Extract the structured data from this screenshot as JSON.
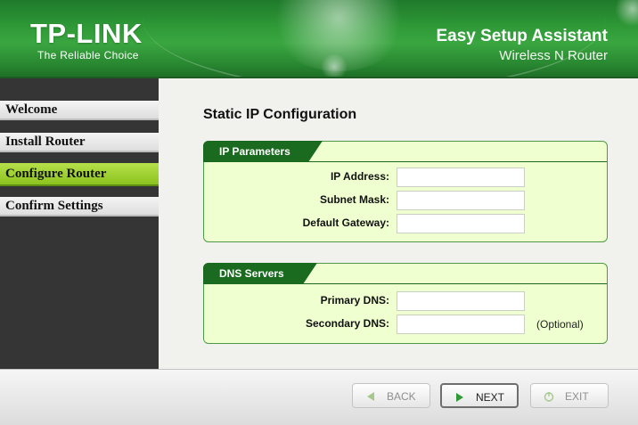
{
  "header": {
    "logo": "TP-LINK",
    "tagline": "The Reliable Choice",
    "title": "Easy Setup Assistant",
    "subtitle": "Wireless N Router"
  },
  "sidebar": {
    "items": [
      {
        "label": "Welcome",
        "active": false
      },
      {
        "label": "Install Router",
        "active": false
      },
      {
        "label": "Configure Router",
        "active": true
      },
      {
        "label": "Confirm Settings",
        "active": false
      }
    ]
  },
  "main": {
    "page_title": "Static IP Configuration",
    "ip_parameters": {
      "legend": "IP Parameters",
      "fields": {
        "ip_address": {
          "label": "IP Address:",
          "value": ""
        },
        "subnet_mask": {
          "label": "Subnet Mask:",
          "value": ""
        },
        "default_gateway": {
          "label": "Default Gateway:",
          "value": ""
        }
      }
    },
    "dns_servers": {
      "legend": "DNS Servers",
      "fields": {
        "primary_dns": {
          "label": "Primary DNS:",
          "value": ""
        },
        "secondary_dns": {
          "label": "Secondary DNS:",
          "value": "",
          "note": "(Optional)"
        }
      }
    }
  },
  "footer": {
    "back_label": "BACK",
    "next_label": "NEXT",
    "exit_label": "EXIT"
  },
  "colors": {
    "brand_green": "#2f9a37",
    "fieldset_header": "#1a6a1f",
    "fieldset_bg": "#efffd0",
    "active_nav": "#8cc31f",
    "sidebar_bg": "#353535"
  },
  "icons": {
    "back": "back-arrow-icon",
    "next": "next-arrow-icon",
    "exit": "exit-power-icon"
  }
}
